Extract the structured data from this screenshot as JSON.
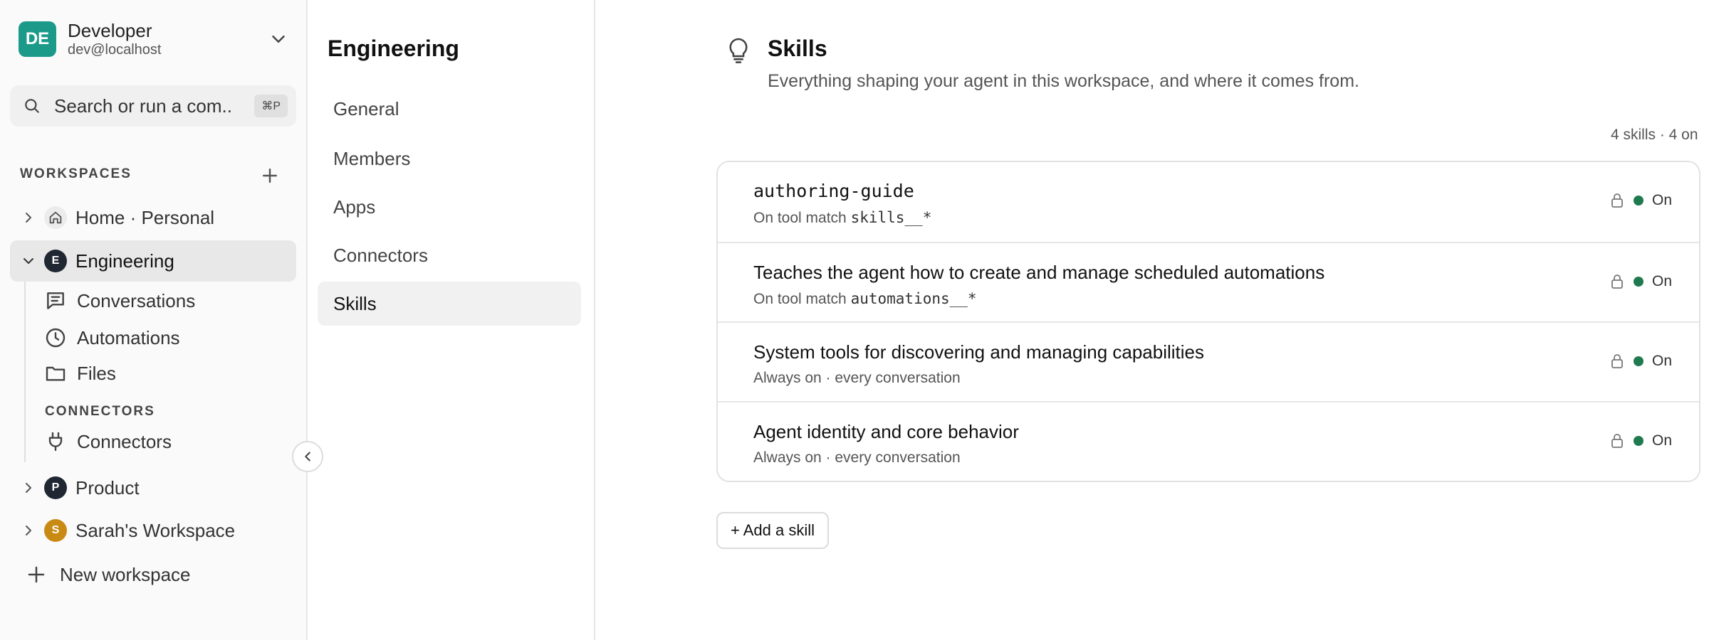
{
  "user": {
    "initials": "DE",
    "name": "Developer",
    "email": "dev@localhost",
    "avatar_color": "#1b9a8a"
  },
  "search": {
    "placeholder": "Search or run a com...",
    "shortcut": "⌘P"
  },
  "workspaces": {
    "header": "WORKSPACES",
    "items": [
      {
        "label": "Home · Personal",
        "icon": "home-icon"
      },
      {
        "label": "Engineering",
        "initial": "E",
        "color": "#1f2733",
        "expanded": true
      },
      {
        "label": "Product",
        "initial": "P",
        "color": "#1f2733"
      },
      {
        "label": "Sarah's Workspace",
        "initial": "S",
        "color": "#c98a14"
      }
    ],
    "engineering_children": [
      {
        "label": "Conversations",
        "icon": "chat-icon"
      },
      {
        "label": "Automations",
        "icon": "clock-icon"
      },
      {
        "label": "Files",
        "icon": "folder-icon"
      }
    ],
    "connectors_header": "CONNECTORS",
    "connectors_item": {
      "label": "Connectors",
      "icon": "plug-icon"
    },
    "new_workspace": "New workspace"
  },
  "settings_menu": {
    "title": "Engineering",
    "items": [
      "General",
      "Members",
      "Apps",
      "Connectors",
      "Skills"
    ],
    "active": "Skills"
  },
  "main": {
    "title": "Skills",
    "subtitle": "Everything shaping your agent in this workspace, and where it comes from.",
    "counts": "4 skills · 4 on",
    "skills": [
      {
        "title": "authoring-guide",
        "desc_prefix": "On tool match ",
        "desc_code": "skills__*",
        "status": "On",
        "locked": true
      },
      {
        "title": "Teaches the agent how to create and manage scheduled automations",
        "desc_prefix": "On tool match ",
        "desc_code": "automations__*",
        "status": "On",
        "locked": true
      },
      {
        "title": "System tools for discovering and managing capabilities",
        "desc_prefix": "Always on · every conversation",
        "desc_code": "",
        "status": "On",
        "locked": true
      },
      {
        "title": "Agent identity and core behavior",
        "desc_prefix": "Always on · every conversation",
        "desc_code": "",
        "status": "On",
        "locked": true
      }
    ],
    "add_skill_label": "+ Add a skill"
  },
  "colors": {
    "status_on": "#1f7a4f",
    "active_bg": "#e8e8e8"
  }
}
